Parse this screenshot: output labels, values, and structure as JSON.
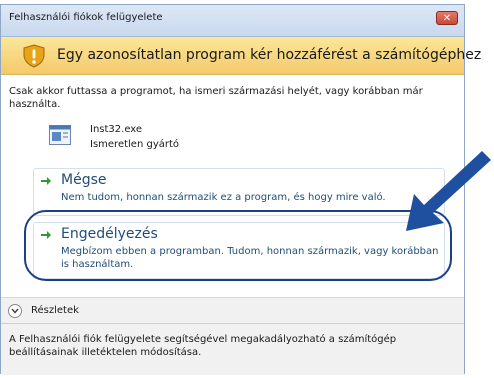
{
  "window": {
    "title": "Felhasználói fiókok felügyelete",
    "close_label": "✕"
  },
  "warning": {
    "heading": "Egy azonosítatlan program kér hozzáférést a számítógéphez",
    "icon": "shield-warning-icon"
  },
  "description": "Csak akkor futtassa a programot, ha ismeri származási helyét, vagy korábban már használta.",
  "program": {
    "name": "Inst32.exe",
    "publisher": "Ismeretlen gyártó",
    "icon": "executable-icon"
  },
  "options": {
    "cancel": {
      "title": "Mégse",
      "subtitle": "Nem tudom, honnan származik ez a program, és hogy mire való."
    },
    "allow": {
      "title": "Engedélyezés",
      "subtitle": "Megbízom ebben a programban. Tudom, honnan származik, vagy korábban is használtam."
    }
  },
  "details": {
    "label": "Részletek"
  },
  "footer": {
    "text": "A Felhasználói fiók felügyelete segítségével megakadályozható a számítógép beállításainak illetéktelen módosítása."
  },
  "colors": {
    "warning_band": "#f4c96b",
    "link_text": "#1f4d7a",
    "annotation_arrow": "#1f4f9f",
    "annotation_ellipse": "#1c3f86",
    "close_button": "#c64a36"
  }
}
